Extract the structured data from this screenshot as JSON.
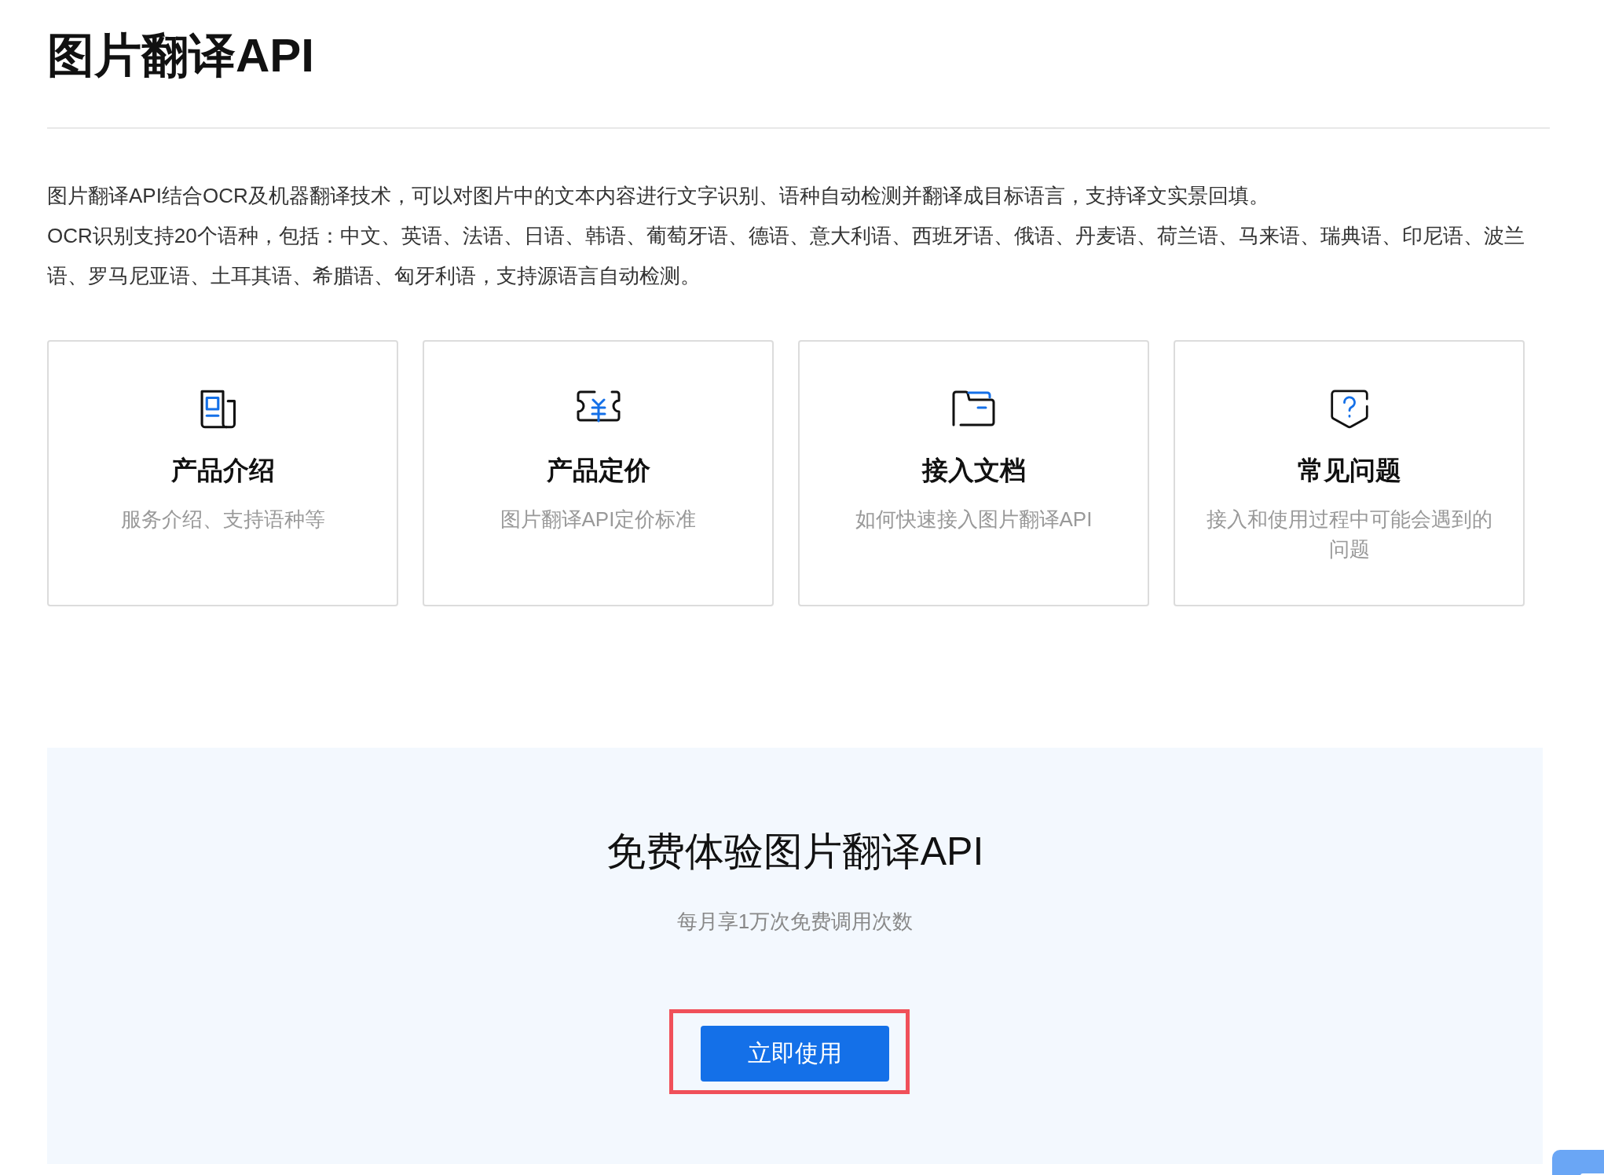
{
  "title": "图片翻译API",
  "intro": [
    "图片翻译API结合OCR及机器翻译技术，可以对图片中的文本内容进行文字识别、语种自动检测并翻译成目标语言，支持译文实景回填。",
    "OCR识别支持20个语种，包括：中文、英语、法语、日语、韩语、葡萄牙语、德语、意大利语、西班牙语、俄语、丹麦语、荷兰语、马来语、瑞典语、印尼语、波兰语、罗马尼亚语、土耳其语、希腊语、匈牙利语，支持源语言自动检测。"
  ],
  "cards": [
    {
      "kind": "intro",
      "title": "产品介绍",
      "desc": "服务介绍、支持语种等"
    },
    {
      "kind": "pricing",
      "title": "产品定价",
      "desc": "图片翻译API定价标准"
    },
    {
      "kind": "docs",
      "title": "接入文档",
      "desc": "如何快速接入图片翻译API"
    },
    {
      "kind": "faq",
      "title": "常见问题",
      "desc": "接入和使用过程中可能会遇到的问题"
    }
  ],
  "trial": {
    "heading": "免费体验图片翻译API",
    "subtitle": "每月享1万次免费调用次数",
    "button": {
      "label": "立即使用",
      "highlighted": true
    }
  }
}
